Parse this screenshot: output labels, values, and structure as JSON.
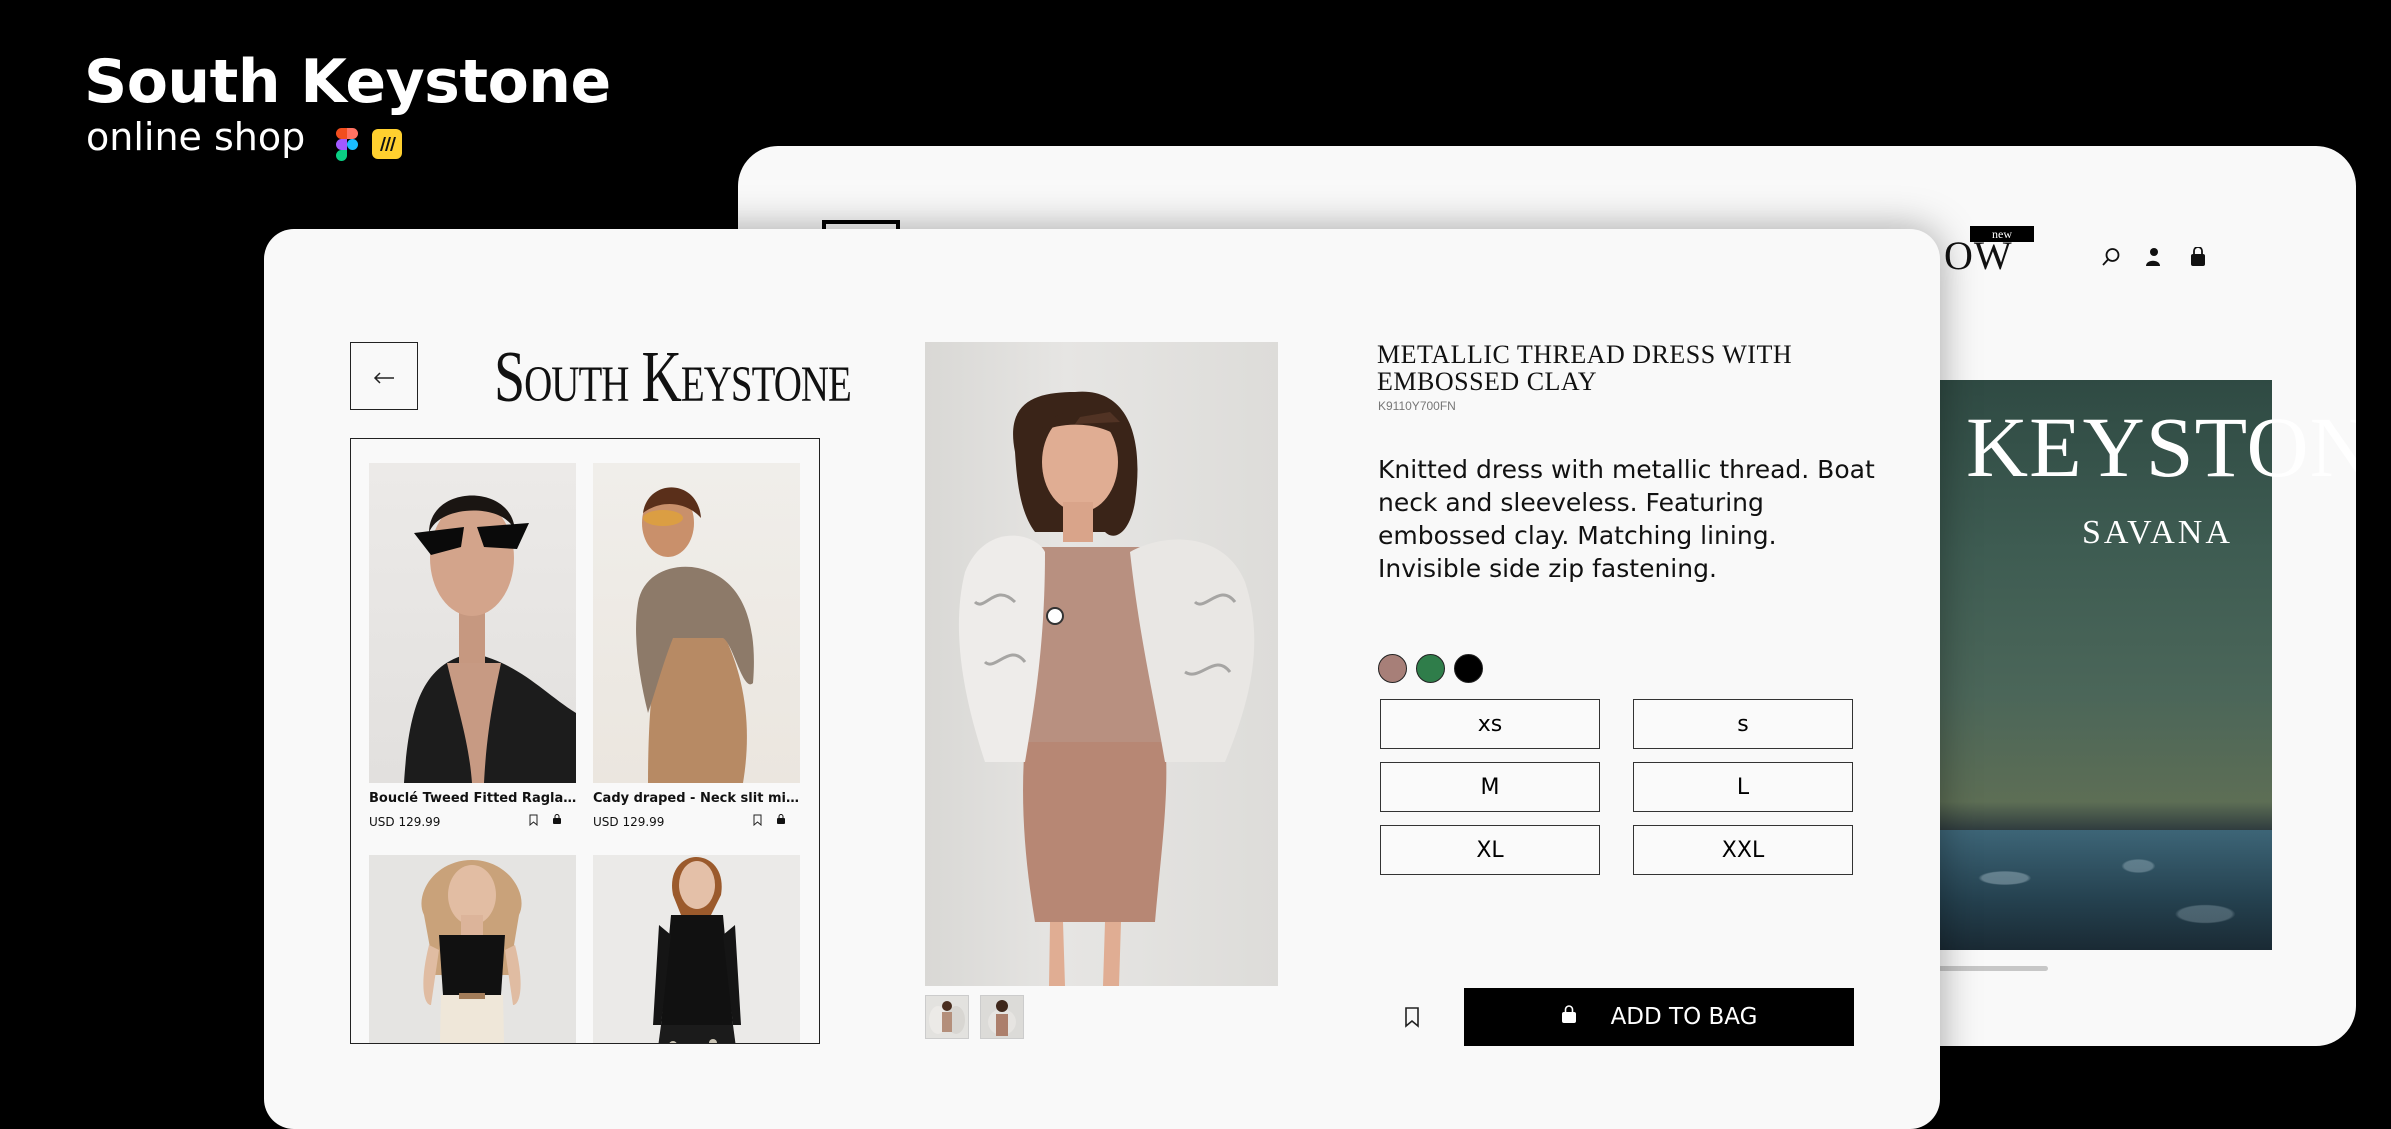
{
  "hero": {
    "title": "South Keystone",
    "subtitle": "online shop",
    "tool_icons": [
      "figma-icon",
      "miro-icon"
    ]
  },
  "home_page": {
    "nav_text_partial": "OW",
    "new_badge": "new",
    "nav_icons": [
      "search-icon",
      "account-icon",
      "bag-icon"
    ],
    "banner": {
      "title": "KEYSTONE",
      "subtitle": "SAVANA"
    }
  },
  "product_page": {
    "logo": "South Keystone",
    "back_icon": "arrow-left-icon",
    "product_list": [
      {
        "name": "Bouclé Tweed Fitted Raglan Blazer",
        "price": "USD 129.99"
      },
      {
        "name": "Cady draped - Neck slit mini dress",
        "price": "USD 129.99"
      },
      {
        "name": "",
        "price": ""
      },
      {
        "name": "",
        "price": ""
      }
    ],
    "product": {
      "title": "METALLIC THREAD DRESS WITH EMBOSSED CLAY",
      "sku": "K9110Y700FN",
      "description": "Knitted dress with metallic thread. Boat neck and sleeveless. Featuring embossed clay. Matching lining. Invisible side zip fastening.",
      "colors": [
        "#a77f78",
        "#2f7d4a",
        "#000000"
      ],
      "sizes": [
        "xs",
        "s",
        "M",
        "L",
        "XL",
        "XXL"
      ],
      "add_to_bag_label": "ADD TO BAG"
    }
  }
}
